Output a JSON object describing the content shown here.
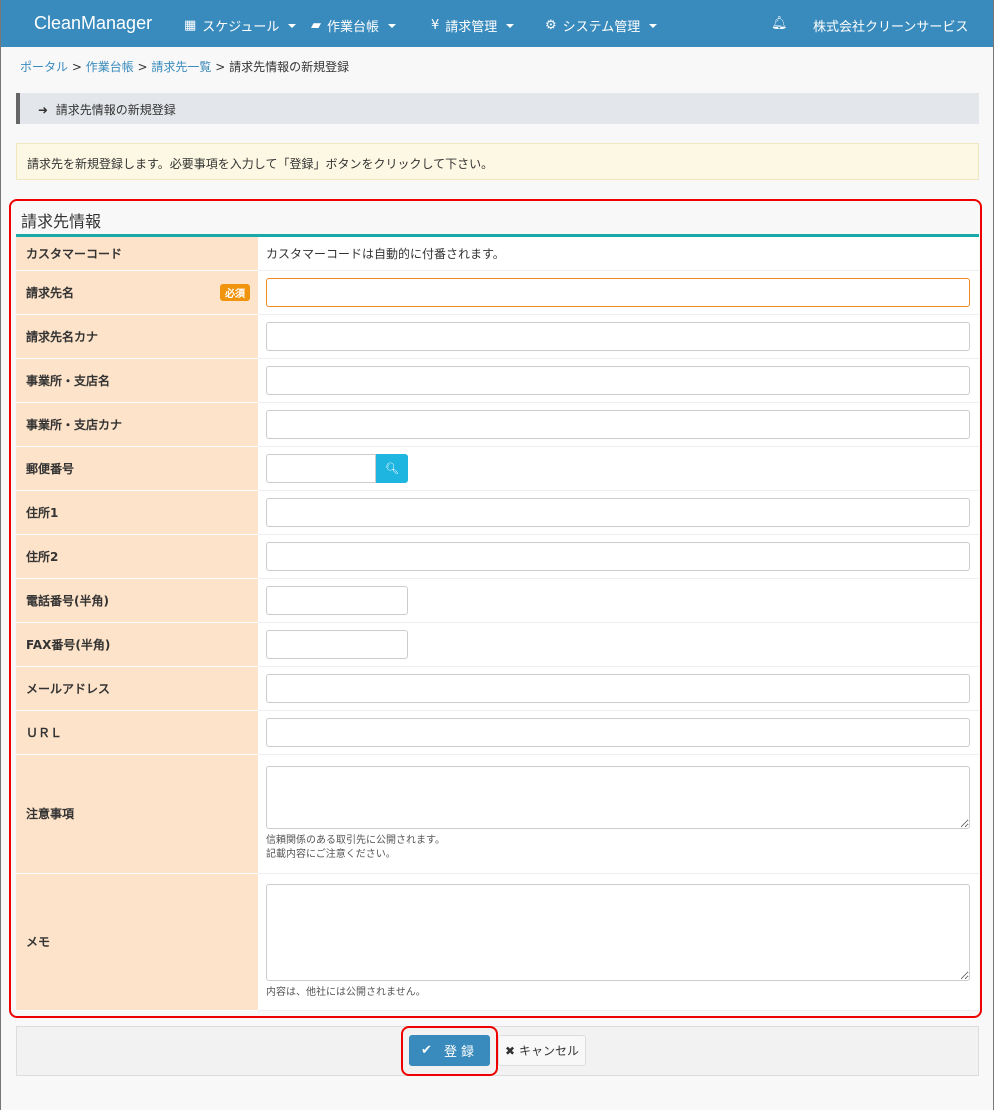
{
  "nav": {
    "brand": "CleanManager",
    "items": [
      {
        "label": "スケジュール",
        "icon": "calendar-icon"
      },
      {
        "label": "作業台帳",
        "icon": "book-icon"
      },
      {
        "label": "請求管理",
        "icon": "yen-icon"
      },
      {
        "label": "システム管理",
        "icon": "cogs-icon"
      }
    ],
    "company": "株式会社クリーンサービス"
  },
  "breadcrumb": [
    "ポータル",
    "作業台帳",
    "請求先一覧",
    "請求先情報の新規登録"
  ],
  "title": "請求先情報の新規登録",
  "notice": "請求先を新規登録します。必要事項を入力して「登録」ボタンをクリックして下さい。",
  "panel_title": "請求先情報",
  "required_badge": "必須",
  "fields": {
    "customer_code": "カスタマーコード",
    "customer_code_note": "カスタマーコードは自動的に付番されます。",
    "name": "請求先名",
    "kana": "請求先名カナ",
    "office": "事業所・支店名",
    "office_kana": "事業所・支店カナ",
    "zip": "郵便番号",
    "addr1": "住所1",
    "addr2": "住所2",
    "tel": "電話番号(半角)",
    "fax": "FAX番号(半角)",
    "mail": "メールアドレス",
    "url": "ＵＲＬ",
    "caution": "注意事項",
    "caution_help1": "信頼関係のある取引先に公開されます。",
    "caution_help2": "記載内容にご注意ください。",
    "memo": "メモ",
    "memo_help": "内容は、他社には公開されません。"
  },
  "buttons": {
    "submit": "登録",
    "cancel": "キャンセル"
  }
}
